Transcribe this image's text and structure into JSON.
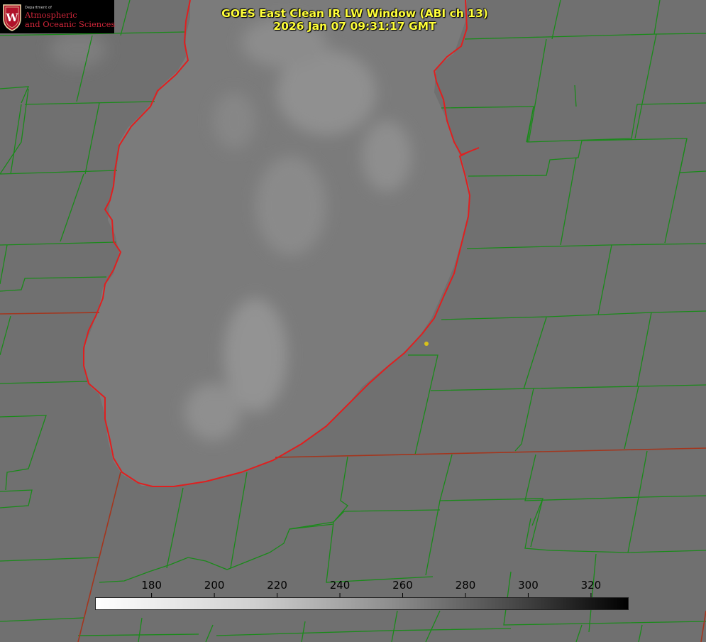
{
  "title": {
    "line1": "GOES East Clean IR LW Window (ABI ch 13)",
    "line2": "2026 Jan 07 09:31:17 GMT"
  },
  "logo": {
    "department": "Department of",
    "line1": "Atmospheric",
    "line2": "and Oceanic Sciences"
  },
  "colorbar": {
    "ticks": [
      "180",
      "200",
      "220",
      "240",
      "260",
      "280",
      "300",
      "320"
    ],
    "range": [
      162,
      332
    ],
    "tick_values": [
      180,
      200,
      220,
      240,
      260,
      280,
      300,
      320
    ],
    "palette": "inverted-grayscale"
  },
  "colors": {
    "background": "#707070",
    "lake_fill": "#7a7a7a",
    "county_lines": "#1a8a1a",
    "state_lines": "#c0301a",
    "lake_outline": "#e01f1f",
    "title_text": "#ffff3a",
    "marker": "#d8c21a",
    "logo_red": "#d1263a"
  }
}
